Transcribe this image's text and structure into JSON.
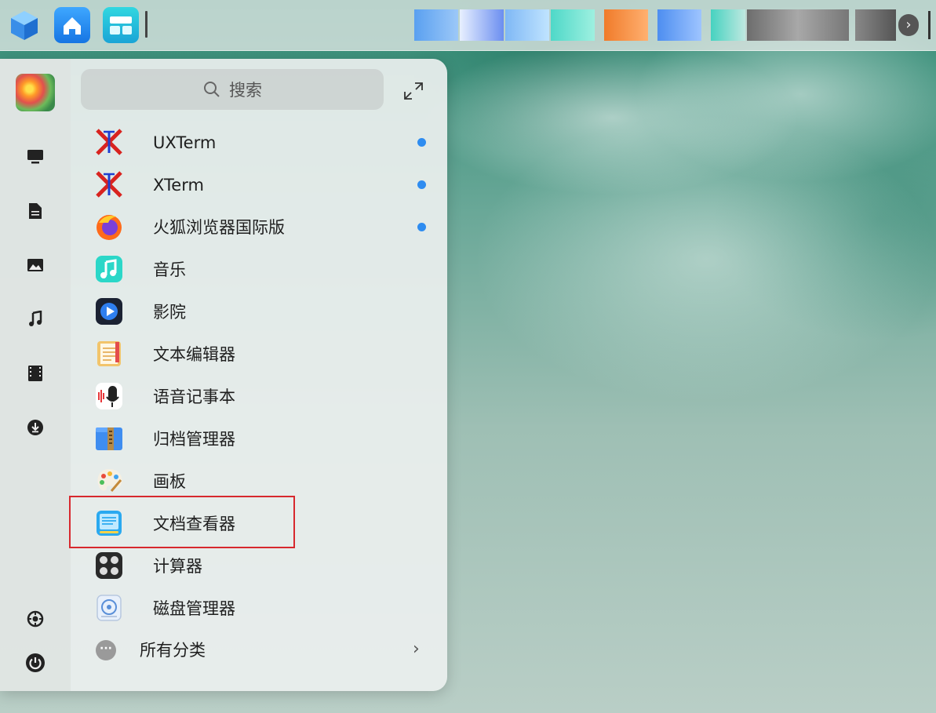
{
  "launcher": {
    "search_placeholder": "搜索",
    "apps": [
      {
        "label": "UXTerm",
        "icon": "xterm-icon",
        "new": true
      },
      {
        "label": "XTerm",
        "icon": "xterm-icon",
        "new": true
      },
      {
        "label": "火狐浏览器国际版",
        "icon": "firefox-icon",
        "new": true
      },
      {
        "label": "音乐",
        "icon": "music-app-icon",
        "new": false
      },
      {
        "label": "影院",
        "icon": "movie-player-icon",
        "new": false
      },
      {
        "label": "文本编辑器",
        "icon": "text-editor-icon",
        "new": false
      },
      {
        "label": "语音记事本",
        "icon": "voice-note-icon",
        "new": false
      },
      {
        "label": "归档管理器",
        "icon": "archive-manager-icon",
        "new": false
      },
      {
        "label": "画板",
        "icon": "draw-icon",
        "new": false
      },
      {
        "label": "文档查看器",
        "icon": "document-viewer-icon",
        "new": false
      },
      {
        "label": "计算器",
        "icon": "calculator-icon",
        "new": false
      },
      {
        "label": "磁盘管理器",
        "icon": "disk-manager-icon",
        "new": false
      }
    ],
    "all_categories": "所有分类"
  },
  "colors": {
    "highlight_box": "#d7282e",
    "new_dot": "#2e8cf0"
  }
}
